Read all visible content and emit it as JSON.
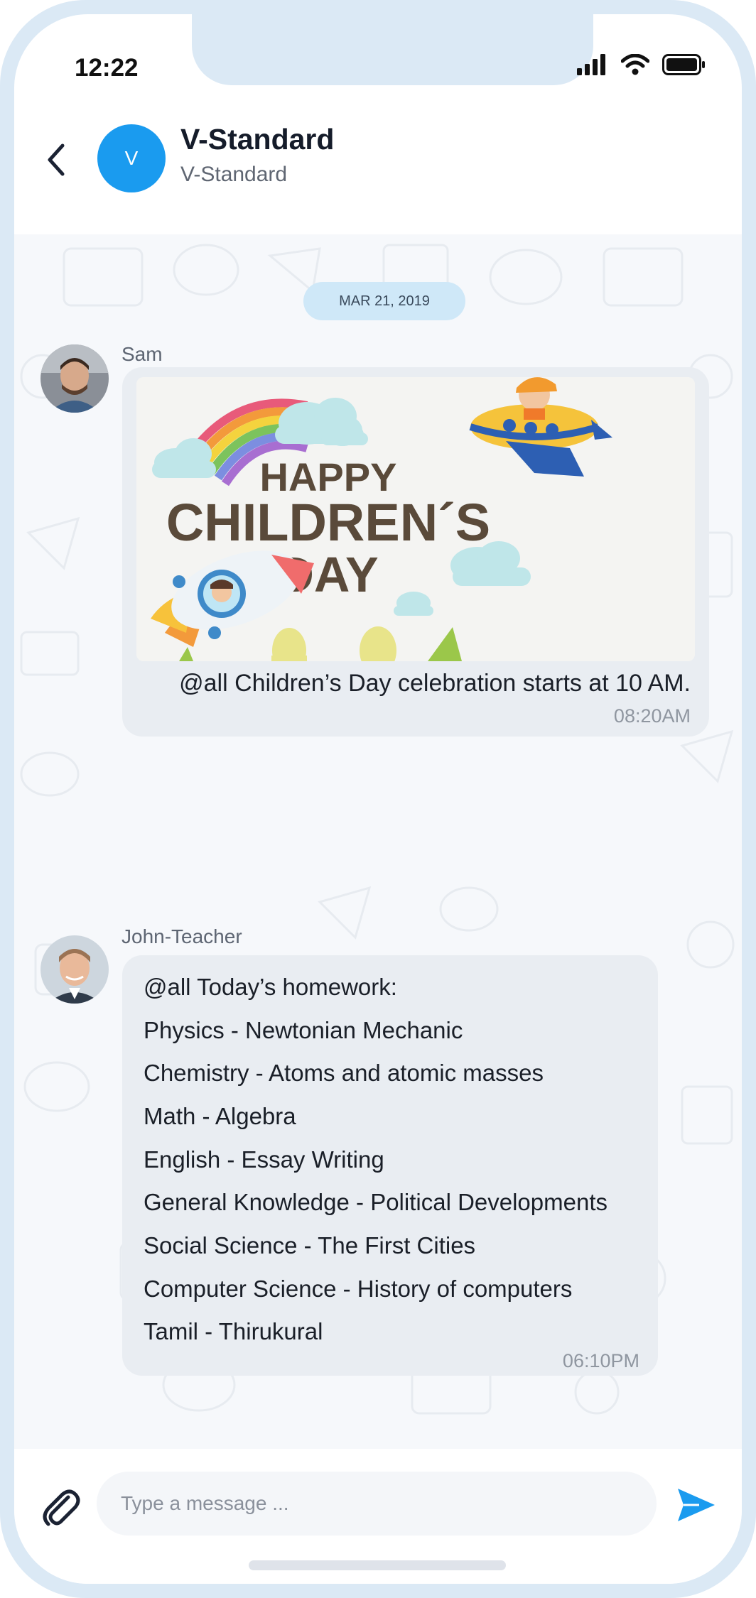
{
  "status_bar": {
    "time": "12:22"
  },
  "header": {
    "avatar_letter": "V",
    "title": "V-Standard",
    "subtitle": "V-Standard"
  },
  "chat": {
    "date": "MAR 21, 2019",
    "messages": [
      {
        "sender": "Sam",
        "image_text": {
          "line1": "HAPPY",
          "line2": "CHILDREN´S",
          "line3": "DAY"
        },
        "caption": "@all Children’s Day celebration starts at 10 AM.",
        "time": "08:20AM"
      },
      {
        "sender": "John-Teacher",
        "lines": [
          "@all Today’s homework:",
          "Physics - Newtonian Mechanic",
          "Chemistry - Atoms and atomic masses",
          "Math - Algebra",
          "English - Essay Writing",
          "General Knowledge - Political Developments",
          "Social Science - The First Cities",
          "Computer Science - History of computers",
          "Tamil - Thirukural"
        ],
        "time": "06:10PM"
      }
    ]
  },
  "composer": {
    "placeholder": "Type a message ..."
  },
  "colors": {
    "accent": "#1a9bef",
    "bubble": "#e9edf2",
    "frame": "#dbe9f5",
    "date_pill": "#cfe8f8"
  },
  "icons": {
    "back": "chevron-left-icon",
    "attach": "paperclip-icon",
    "send": "send-icon",
    "signal": "signal-icon",
    "wifi": "wifi-icon",
    "battery": "battery-icon"
  }
}
